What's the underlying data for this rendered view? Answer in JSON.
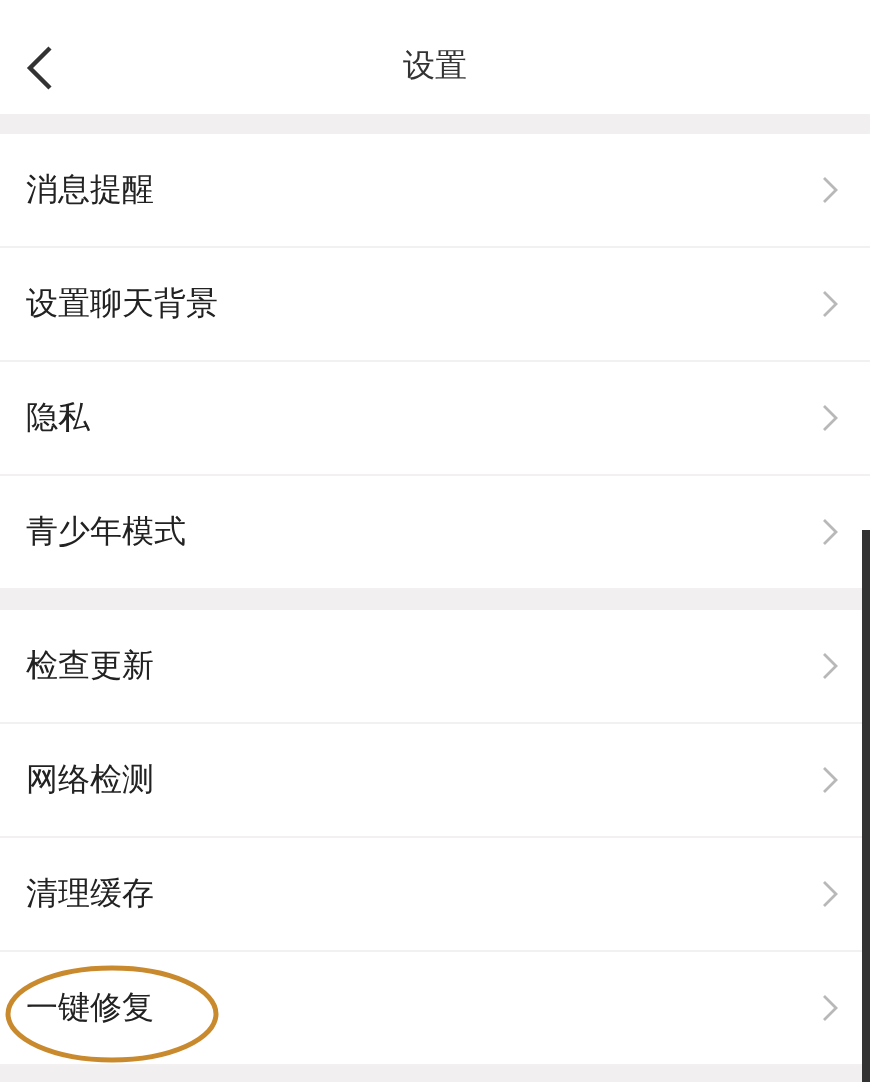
{
  "header": {
    "title": "设置"
  },
  "groups": [
    {
      "items": [
        {
          "label": "消息提醒",
          "circled": false
        },
        {
          "label": "设置聊天背景",
          "circled": false
        },
        {
          "label": "隐私",
          "circled": false
        },
        {
          "label": "青少年模式",
          "circled": false
        }
      ]
    },
    {
      "items": [
        {
          "label": "检查更新",
          "circled": false
        },
        {
          "label": "网络检测",
          "circled": false
        },
        {
          "label": "清理缓存",
          "circled": false
        },
        {
          "label": "一键修复",
          "circled": true
        }
      ]
    }
  ]
}
